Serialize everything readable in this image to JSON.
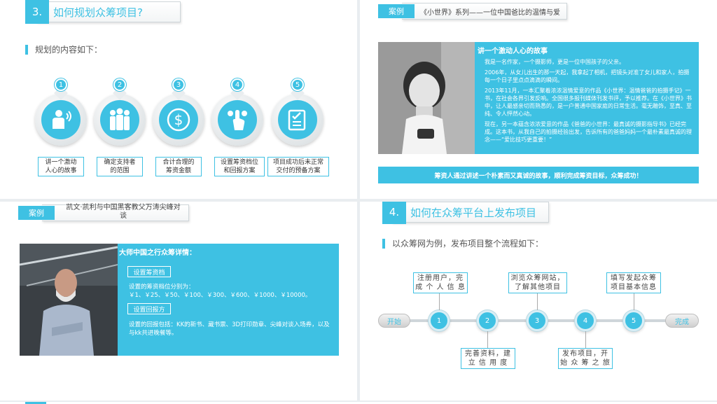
{
  "slide1": {
    "number": "3.",
    "title": "如何规划众筹项目?",
    "lead": "规划的内容如下：",
    "items": [
      {
        "num": "1",
        "label": "讲一个激动人心的故事",
        "icon": "speaker-person-icon"
      },
      {
        "num": "2",
        "label": "确定支持者的范围",
        "icon": "people-group-icon"
      },
      {
        "num": "3",
        "label": "合计合理的筹资金额",
        "icon": "dollar-coin-icon"
      },
      {
        "num": "4",
        "label": "设置筹资档位和回报方案",
        "icon": "hand-tap-icon"
      },
      {
        "num": "5",
        "label": "项目成功后未正常交付的预备方案",
        "icon": "checklist-icon"
      }
    ],
    "captions": [
      [
        "讲一个激动",
        "人心的故事"
      ],
      [
        "确定支持者",
        "的范围"
      ],
      [
        "合计合理的",
        "筹资金额"
      ],
      [
        "设置筹资档位",
        "和回报方案"
      ],
      [
        "项目成功后未正常",
        "交付的预备方案"
      ]
    ]
  },
  "slide2": {
    "tag": "案例",
    "title": "《小世界》系列——一位中国爸比的温情与爱",
    "panel_heading": "讲一个激动人心的故事",
    "paragraphs": [
      "我是一名作家，一个摄影师，更是一位中国孩子的父亲。",
      "2006年，从女儿出生的那一天起，我拿起了相机，把镜头对准了女儿和家人，拍摄每一个日子里点点滴滴的瞬间。",
      "2013年11月，一本汇聚着浓浓温情爱意的作品《小世界：温情爸爸的拍摄手记》一书，在社会各界引发反响。全国很多报刊媒体刊发书评，予以推荐。在《小世界》书中，让人最感亲切而熟悉的，是一户普通中国家庭的日常生活。毫无雕饰，至真、至纯、令人怦然心动。",
      "现在，另一本蕴含浓浓爱意的作品《爸爸的小世界：最真诚的摄影指导书》已经完成。这本书，从我自己的拍摄经验出发，告诉所有的爸爸妈妈一个最朴素最真诚的理念——“爱比技巧更重要！”"
    ],
    "bottom_bar": "筹资人通过讲述一个朴素而又真诚的故事，顺利完成筹资目标，众筹成功！"
  },
  "slide3": {
    "tag": "案例",
    "title_lines": [
      "凯文·凯利与中国黑客教父万涛尖峰对",
      "谈"
    ],
    "panel_heading": "大师中国之行众筹详情：",
    "label1": "设置筹资档",
    "text1": "设置的筹资档位分别为：￥1、￥25、￥50、￥100、￥300、￥600、￥1000、￥10000。",
    "label2": "设置回报方",
    "text2": "设置的回报包括：KK的新书、藏书票、3D打印勋章、尖峰对谈入场券，以及与kk共进晚餐等。"
  },
  "slide4": {
    "number": "4.",
    "title": "如何在众筹平台上发布项目",
    "lead": "以众筹网为例，发布项目整个流程如下：",
    "start": "开始",
    "end": "完成",
    "steps": [
      "1",
      "2",
      "3",
      "4",
      "5"
    ],
    "top_boxes": [
      [
        "注册用户，完",
        "成 个 人 信 息"
      ],
      [
        "浏览众筹网站，",
        "了解其他项目"
      ],
      [
        "填写发起众筹",
        "项目基本信息"
      ]
    ],
    "bottom_boxes": [
      [
        "完善资料，建",
        "立  信  用  度"
      ],
      [
        "发布项目，开",
        "始 众 筹 之 旅"
      ]
    ]
  },
  "colors": {
    "accent": "#3ec1e3"
  }
}
